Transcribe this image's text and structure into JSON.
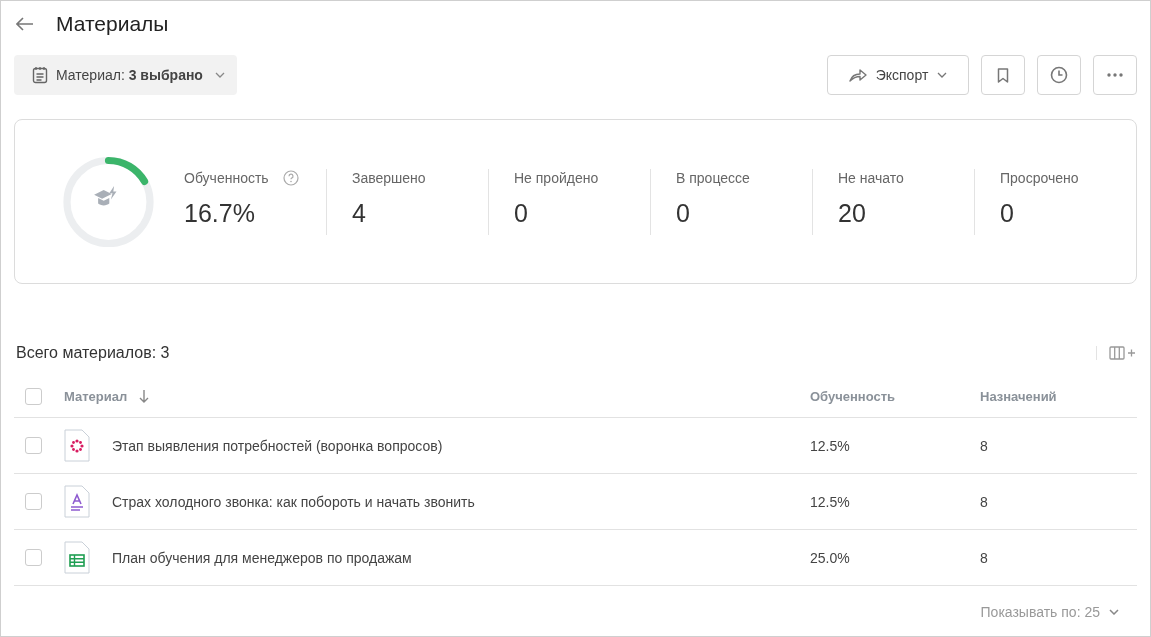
{
  "header": {
    "title": "Материалы"
  },
  "filter": {
    "label": "Материал: **3 выбрано**"
  },
  "toolbar": {
    "export_label": "Экспорт"
  },
  "summary": {
    "level": 0.167,
    "stats": [
      {
        "label": "Обученность",
        "value": "16.7%",
        "help": true
      },
      {
        "label": "Завершено",
        "value": "4",
        "help": false
      },
      {
        "label": "Не пройдено",
        "value": "0",
        "help": false
      },
      {
        "label": "В процессе",
        "value": "0",
        "help": false
      },
      {
        "label": "Не начато",
        "value": "20",
        "help": false
      },
      {
        "label": "Просрочено",
        "value": "0",
        "help": false
      }
    ]
  },
  "table": {
    "title": "Всего материалов: 3",
    "select_all_checked": false,
    "columns": [
      "Материал",
      "Обученность",
      "Назначений"
    ],
    "rows": [
      {
        "kind": "quiz",
        "checked": false,
        "name": "Этап выявления потребностей (воронка вопросов)",
        "progress": "12.5%",
        "assignments": "8"
      },
      {
        "kind": "article",
        "checked": false,
        "name": "Страх холодного звонка: как побороть и начать звонить",
        "progress": "12.5%",
        "assignments": "8"
      },
      {
        "kind": "spreadsheet",
        "checked": false,
        "name": "План обучения для менеджеров по продажам",
        "progress": "25.0%",
        "assignments": "8"
      }
    ]
  },
  "footer": {
    "page_size": "Показывать по: 25"
  }
}
